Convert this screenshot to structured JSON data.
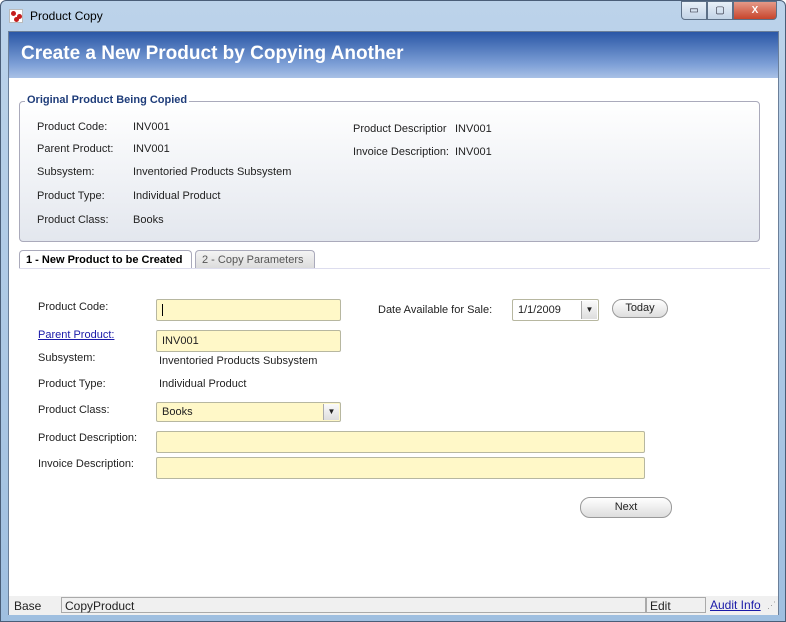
{
  "window": {
    "title": "Product Copy",
    "controls": {
      "minimize": "▭",
      "maximize": "▢",
      "close": "X"
    }
  },
  "header": {
    "title": "Create a New Product by Copying Another"
  },
  "original": {
    "legend": "Original Product Being Copied",
    "fields": [
      {
        "label": "Product Code:",
        "value": "INV001"
      },
      {
        "label": "Parent Product:",
        "value": "INV001"
      },
      {
        "label": "Subsystem:",
        "value": "Inventoried Products Subsystem"
      },
      {
        "label": "Product Type:",
        "value": "Individual Product"
      },
      {
        "label": "Product Class:",
        "value": "Books"
      }
    ],
    "right_fields": [
      {
        "label": "Product Descriptior",
        "value": "INV001"
      },
      {
        "label": "Invoice Description:",
        "value": "INV001"
      }
    ]
  },
  "tabs": [
    {
      "label": "1 - New Product to be Created",
      "active": true
    },
    {
      "label": "2 - Copy Parameters",
      "active": false
    }
  ],
  "form": {
    "product_code": {
      "label": "Product Code:",
      "value": ""
    },
    "parent_product": {
      "label": "Parent Product:",
      "value": "INV001"
    },
    "subsystem": {
      "label": "Subsystem:",
      "value": "Inventoried Products Subsystem"
    },
    "product_type": {
      "label": "Product Type:",
      "value": "Individual Product"
    },
    "product_class": {
      "label": "Product Class:",
      "value": "Books"
    },
    "product_description": {
      "label": "Product Description:",
      "value": ""
    },
    "invoice_description": {
      "label": "Invoice Description:",
      "value": ""
    },
    "date_available": {
      "label": "Date Available for Sale:",
      "value": "1/1/2009"
    },
    "today_label": "Today",
    "next_label": "Next"
  },
  "status": {
    "base": "Base",
    "name": "CopyProduct",
    "mode": "Edit",
    "audit": "Audit Info"
  }
}
